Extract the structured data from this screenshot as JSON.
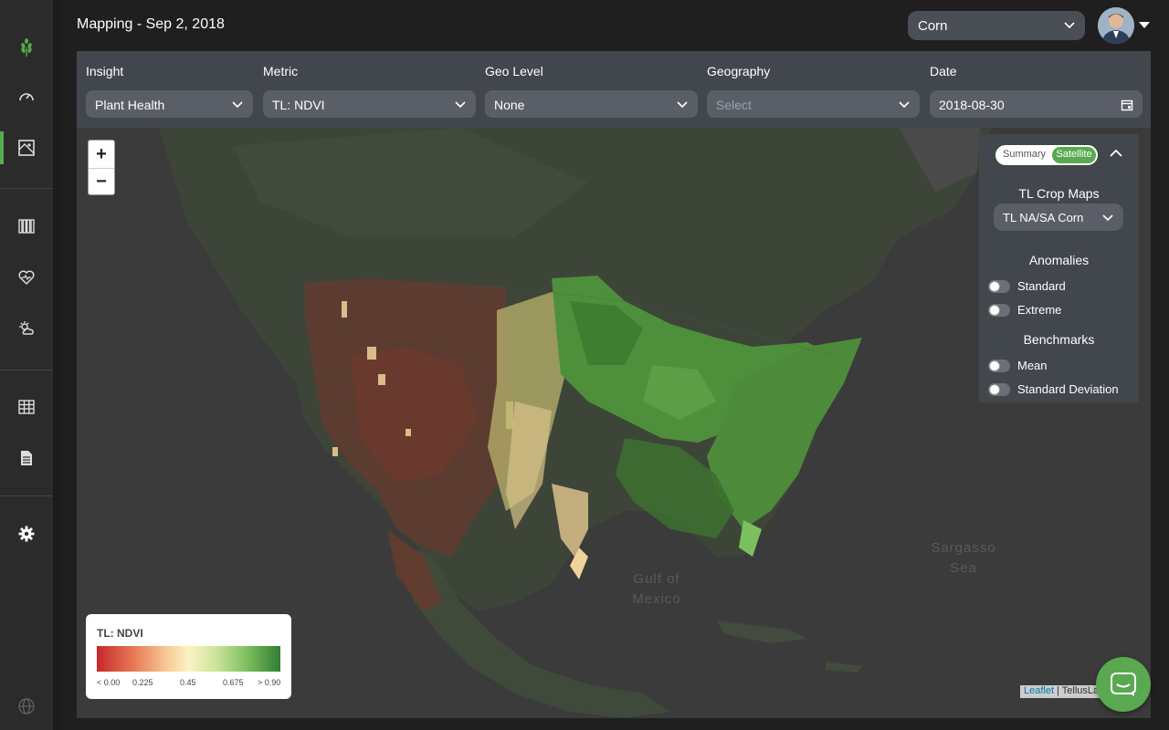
{
  "app": {
    "page_title": "Mapping - Sep 2, 2018"
  },
  "header": {
    "crop_selected": "Corn"
  },
  "sidebar": {
    "items": [
      {
        "icon": "wheat-logo-icon"
      },
      {
        "icon": "dashboard-gauge-icon"
      },
      {
        "icon": "map-icon",
        "active": true
      },
      {
        "icon": "columns-icon"
      },
      {
        "icon": "heart-health-icon"
      },
      {
        "icon": "weather-icon"
      },
      {
        "icon": "table-icon"
      },
      {
        "icon": "document-icon"
      },
      {
        "icon": "settings-gear-icon"
      },
      {
        "icon": "globe-icon"
      }
    ],
    "accent_color": "#5aa84f"
  },
  "filters": {
    "insight": {
      "label": "Insight",
      "value": "Plant Health"
    },
    "metric": {
      "label": "Metric",
      "value": "TL: NDVI"
    },
    "geo_level": {
      "label": "Geo Level",
      "value": "None"
    },
    "geography": {
      "label": "Geography",
      "placeholder": "Select"
    },
    "date": {
      "label": "Date",
      "value": "2018-08-30"
    }
  },
  "map": {
    "zoom_in": "+",
    "zoom_out": "−",
    "labels": {
      "gulf": "Gulf of\nMexico",
      "sargasso": "Sargasso\nSea"
    },
    "attribution": {
      "link": "Leaflet",
      "text": " | TellusLa"
    }
  },
  "legend": {
    "title": "TL: NDVI",
    "ticks": [
      "< 0.00",
      "0.225",
      "0.45",
      "0.675",
      "> 0.90"
    ],
    "colors": [
      "#c62828",
      "#e8825a",
      "#fbf3c4",
      "#7cbf5f",
      "#2e7d32"
    ]
  },
  "panel": {
    "view_toggle": {
      "summary": "Summary",
      "satellite": "Satellite",
      "selected": "Satellite"
    },
    "crop_maps_title": "TL Crop Maps",
    "crop_map_selected": "TL NA/SA Corn",
    "anomalies_title": "Anomalies",
    "anomalies": [
      "Standard",
      "Extreme"
    ],
    "benchmarks_title": "Benchmarks",
    "benchmarks": [
      "Mean",
      "Standard Deviation"
    ]
  }
}
